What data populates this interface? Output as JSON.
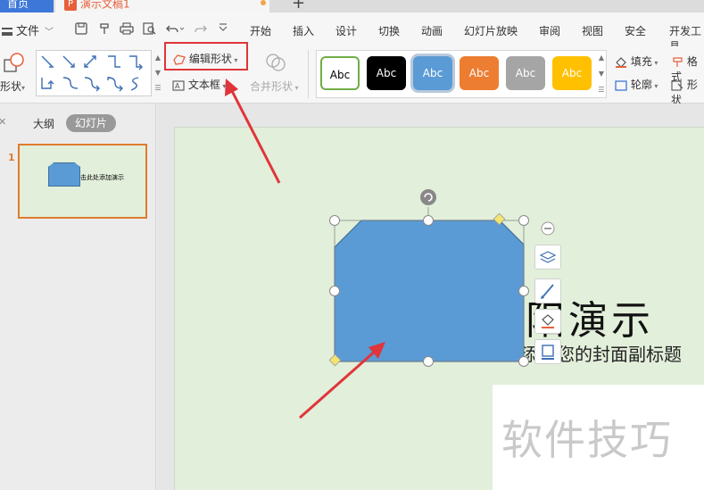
{
  "tabs": {
    "home": "首页",
    "doc_badge": "P",
    "doc_title": "演示文稿1",
    "new_tab": "+"
  },
  "menu": {
    "file": "文件",
    "items": [
      "开始",
      "插入",
      "设计",
      "切换",
      "动画",
      "幻灯片放映",
      "审阅",
      "视图",
      "安全",
      "开发工具"
    ]
  },
  "ribbon": {
    "shape_label": "形状",
    "edit_shape": "编辑形状",
    "textbox": "文本框",
    "merge_shape": "合并形状",
    "style_samples": [
      "Abc",
      "Abc",
      "Abc",
      "Abc",
      "Abc",
      "Abc"
    ],
    "fill": "填充",
    "outline": "轮廓",
    "format": "格式",
    "effects": "形状"
  },
  "left_panel": {
    "tab_outline": "大纲",
    "tab_slides": "幻灯片",
    "slide_number": "1",
    "thumb_text": "击此处添加演示"
  },
  "slide": {
    "title_visible": "阳演示",
    "subtitle_visible": "添加您的封面副标题"
  },
  "watermark": "软件技巧",
  "colors": {
    "accent_blue": "#3d77d8",
    "shape_fill": "#5b9bd5",
    "slide_bg": "#e2efda",
    "highlight_red": "#e0353a",
    "thumb_border": "#e07b2e",
    "style_white": "#ffffff",
    "style_black": "#000000",
    "style_blue": "#5b9bd5",
    "style_orange": "#ed7d31",
    "style_gray": "#a5a5a5",
    "style_yellow": "#ffc000"
  }
}
